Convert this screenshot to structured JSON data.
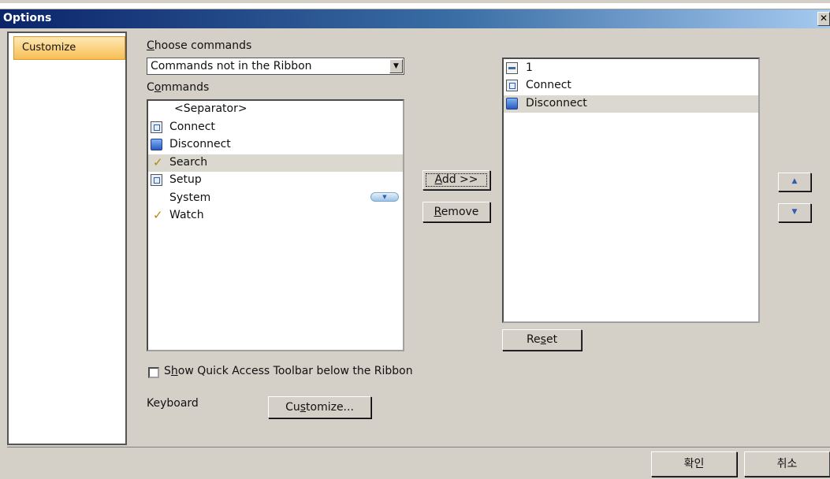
{
  "window": {
    "title": "Options",
    "close_glyph": "✕"
  },
  "nav": {
    "items": [
      {
        "label": "Customize",
        "selected": true
      }
    ]
  },
  "choose": {
    "label_first": "C",
    "label_rest": "hoose commands",
    "selected": "Commands not in the Ribbon",
    "dropdown_glyph": "▼"
  },
  "commands": {
    "label_first": "C",
    "label_u": "o",
    "label_rest": "mmands",
    "items": [
      {
        "label": "<Separator>",
        "icon": "none"
      },
      {
        "label": "Connect",
        "icon": "connect-icon"
      },
      {
        "label": "Disconnect",
        "icon": "disconnect-icon"
      },
      {
        "label": "Search",
        "icon": "checkmark-icon",
        "selected": true
      },
      {
        "label": "Setup",
        "icon": "setup-icon"
      },
      {
        "label": "System",
        "icon": "none",
        "has_dropdown": true
      },
      {
        "label": "Watch",
        "icon": "checkmark-icon"
      }
    ],
    "check_glyph": "✓",
    "dropdown_glyph": "▼"
  },
  "buttons": {
    "add_u": "A",
    "add_rest": "dd >>",
    "remove_u": "R",
    "remove_rest": "emove",
    "reset_a": "Re",
    "reset_u": "s",
    "reset_b": "et",
    "up_glyph": "▲",
    "down_glyph": "▼",
    "customize_a": "Cu",
    "customize_u": "s",
    "customize_b": "tomize...",
    "ok": "확인",
    "cancel": "취소"
  },
  "toolbar": {
    "items": [
      {
        "label": "1",
        "icon": "pin-icon"
      },
      {
        "label": "Connect",
        "icon": "connect-icon"
      },
      {
        "label": "Disconnect",
        "icon": "disconnect-icon",
        "selected": true
      }
    ]
  },
  "qat": {
    "label_a": "S",
    "label_u": "h",
    "label_b": "ow Quick Access Toolbar below the Ribbon",
    "checked": false
  },
  "keyboard": {
    "label": "Keyboard"
  }
}
